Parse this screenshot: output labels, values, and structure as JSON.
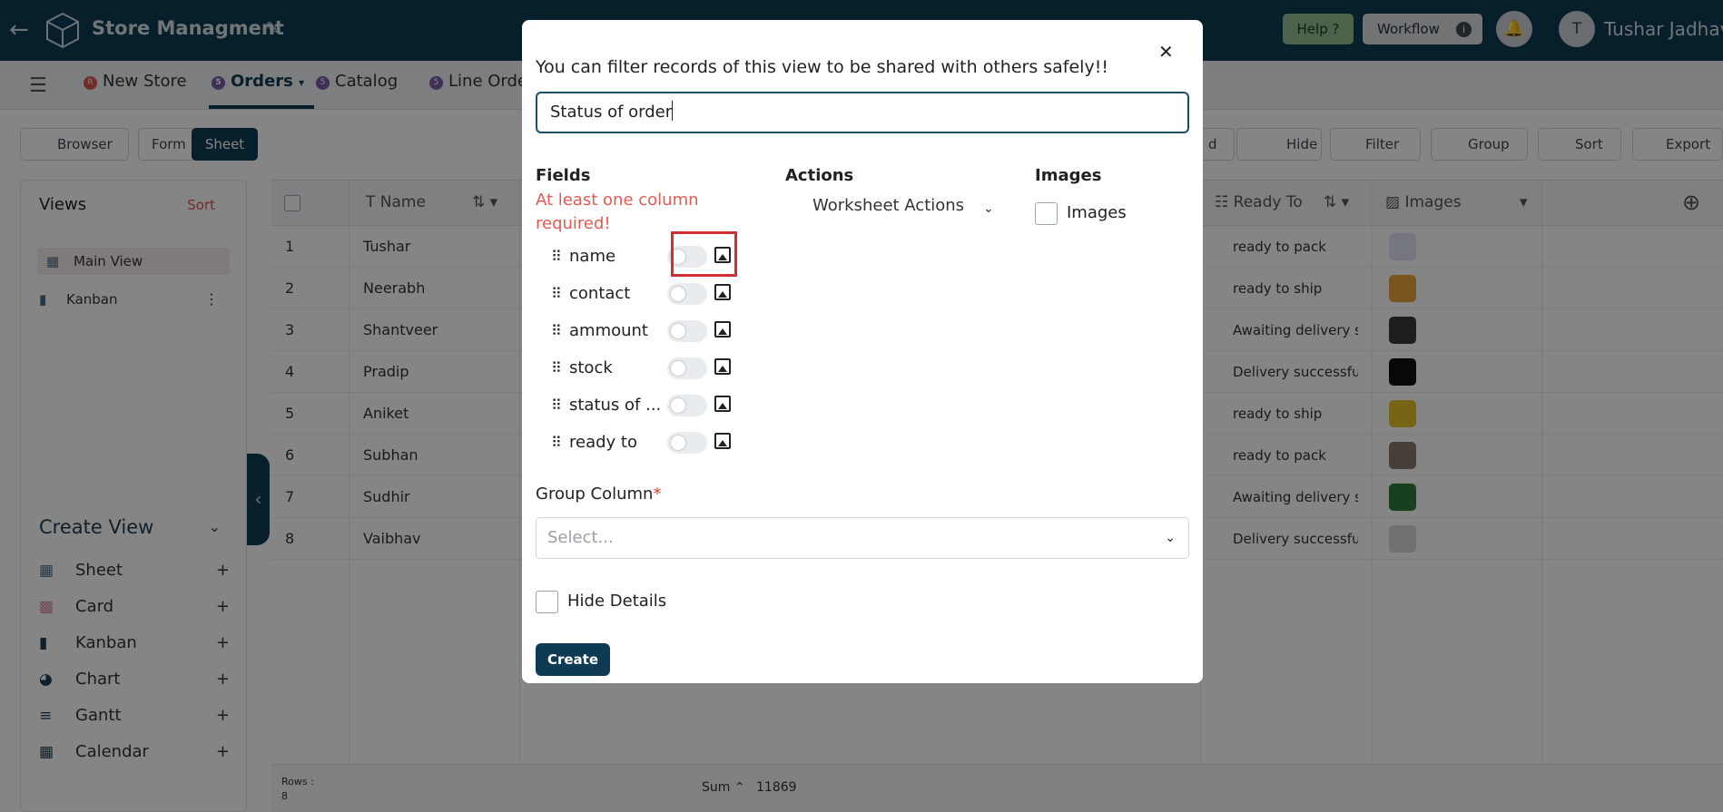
{
  "header": {
    "app_title": "Store Managment",
    "help_label": "Help ?",
    "workflow_label": "Workflow",
    "avatar_initial": "T",
    "user_name": "Tushar Jadhav"
  },
  "tabs": [
    {
      "badge": "R",
      "label": "New Store"
    },
    {
      "badge": "5",
      "label": "Orders"
    },
    {
      "badge": "5",
      "label": "Catalog"
    },
    {
      "badge": "5",
      "label": "Line Orde"
    }
  ],
  "toolbar": {
    "browser": "Browser",
    "form": "Form",
    "sheet": "Sheet",
    "partial": "d",
    "hide": "Hide",
    "filter": "Filter",
    "group": "Group",
    "sort": "Sort",
    "export": "Export"
  },
  "sidebar": {
    "views_title": "Views",
    "sort_label": "Sort",
    "views": [
      "Main View",
      "Kanban"
    ],
    "create_view_title": "Create View",
    "create_items": [
      "Sheet",
      "Card",
      "Kanban",
      "Chart",
      "Gantt",
      "Calendar"
    ]
  },
  "grid": {
    "col_name": "Name",
    "col_ready": "Ready To",
    "col_images": "Images",
    "rows": [
      {
        "num": "1",
        "name": "Tushar",
        "ready": "ready to pack"
      },
      {
        "num": "2",
        "name": "Neerabh",
        "ready": "ready to ship"
      },
      {
        "num": "3",
        "name": "Shantveer",
        "ready": "Awaiting delivery sta"
      },
      {
        "num": "4",
        "name": "Pradip",
        "ready": "Delivery successful"
      },
      {
        "num": "5",
        "name": "Aniket",
        "ready": "ready to ship"
      },
      {
        "num": "6",
        "name": "Subhan",
        "ready": "ready to pack"
      },
      {
        "num": "7",
        "name": "Sudhir",
        "ready": "Awaiting delivery sta"
      },
      {
        "num": "8",
        "name": "Vaibhav",
        "ready": "Delivery successful"
      }
    ],
    "rows_label": "Rows :",
    "rows_count": "8",
    "sum_label": "Sum",
    "sum_value": "11869"
  },
  "modal": {
    "title": "You can filter records of this view to be shared with others safely!!",
    "input_value": "Status of order",
    "fields_title": "Fields",
    "warning": "At least one column required!",
    "fields": [
      "name",
      "contact",
      "ammount",
      "stock",
      "status of ...",
      "ready to"
    ],
    "actions_title": "Actions",
    "actions_select": "Worksheet Actions",
    "images_title": "Images",
    "images_option": "Images",
    "group_label": "Group Column",
    "group_required": "*",
    "group_placeholder": "Select...",
    "hide_details": "Hide Details",
    "create_label": "Create"
  }
}
